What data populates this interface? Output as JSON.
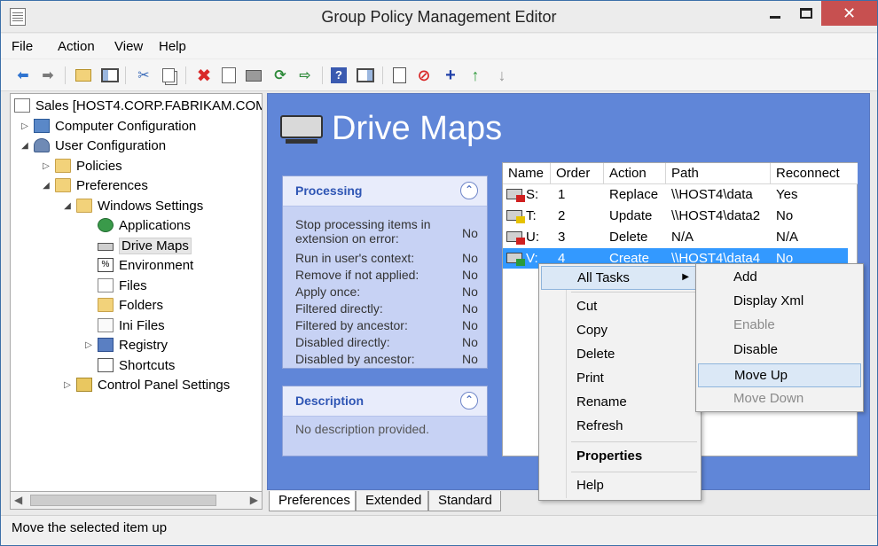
{
  "window": {
    "title": "Group Policy Management Editor",
    "controls": {
      "minimize": "—",
      "maximize": "□",
      "close": "✕"
    }
  },
  "menu": [
    "File",
    "Action",
    "View",
    "Help"
  ],
  "toolbar_icons": [
    "back-icon",
    "forward-icon",
    "up-folder-icon",
    "show-hide-tree-icon",
    "cut-icon",
    "copy-icon",
    "delete-icon",
    "properties-icon",
    "print-icon",
    "refresh-icon",
    "export-icon",
    "help-icon",
    "show-hide-action-icon",
    "view-xml-icon",
    "stop-icon",
    "add-icon",
    "move-up-icon",
    "move-down-icon"
  ],
  "tree": {
    "root": "Sales [HOST4.CORP.FABRIKAM.COM]",
    "computer_configuration": "Computer Configuration",
    "user_configuration": "User Configuration",
    "policies": "Policies",
    "preferences": "Preferences",
    "windows_settings": "Windows Settings",
    "applications": "Applications",
    "drive_maps": "Drive Maps",
    "environment": "Environment",
    "files": "Files",
    "folders": "Folders",
    "ini_files": "Ini Files",
    "registry": "Registry",
    "shortcuts": "Shortcuts",
    "control_panel_settings": "Control Panel Settings"
  },
  "content": {
    "title": "Drive Maps",
    "processing": {
      "header": "Processing",
      "items": [
        {
          "label": "Stop processing items in extension on error:",
          "value": "No"
        },
        {
          "label": "Run in user's context:",
          "value": "No"
        },
        {
          "label": "Remove if not applied:",
          "value": "No"
        },
        {
          "label": "Apply once:",
          "value": "No"
        },
        {
          "label": "Filtered directly:",
          "value": "No"
        },
        {
          "label": "Filtered by ancestor:",
          "value": "No"
        },
        {
          "label": "Disabled directly:",
          "value": "No"
        },
        {
          "label": "Disabled by ancestor:",
          "value": "No"
        }
      ]
    },
    "description": {
      "header": "Description",
      "text": "No description provided."
    },
    "columns": [
      "Name",
      "Order",
      "Action",
      "Path",
      "Reconnect"
    ],
    "rows": [
      {
        "name": "S:",
        "order": "1",
        "action": "Replace",
        "path": "\\\\HOST4\\data",
        "reconnect": "Yes",
        "mark_color": "#d02020"
      },
      {
        "name": "T:",
        "order": "2",
        "action": "Update",
        "path": "\\\\HOST4\\data2",
        "reconnect": "No",
        "mark_color": "#e6c200"
      },
      {
        "name": "U:",
        "order": "3",
        "action": "Delete",
        "path": "N/A",
        "reconnect": "N/A",
        "mark_color": "#d02020"
      },
      {
        "name": "V:",
        "order": "4",
        "action": "Create",
        "path": "\\\\HOST4\\data4",
        "reconnect": "No",
        "mark_color": "#2a9a3a"
      }
    ]
  },
  "tabs": [
    "Preferences",
    "Extended",
    "Standard"
  ],
  "context_menu": {
    "all_tasks": "All Tasks",
    "cut": "Cut",
    "copy": "Copy",
    "delete": "Delete",
    "print": "Print",
    "rename": "Rename",
    "refresh": "Refresh",
    "properties": "Properties",
    "help": "Help"
  },
  "submenu": {
    "add": "Add",
    "display_xml": "Display Xml",
    "enable": "Enable",
    "disable": "Disable",
    "move_up": "Move Up",
    "move_down": "Move Down"
  },
  "status": "Move the selected item up"
}
